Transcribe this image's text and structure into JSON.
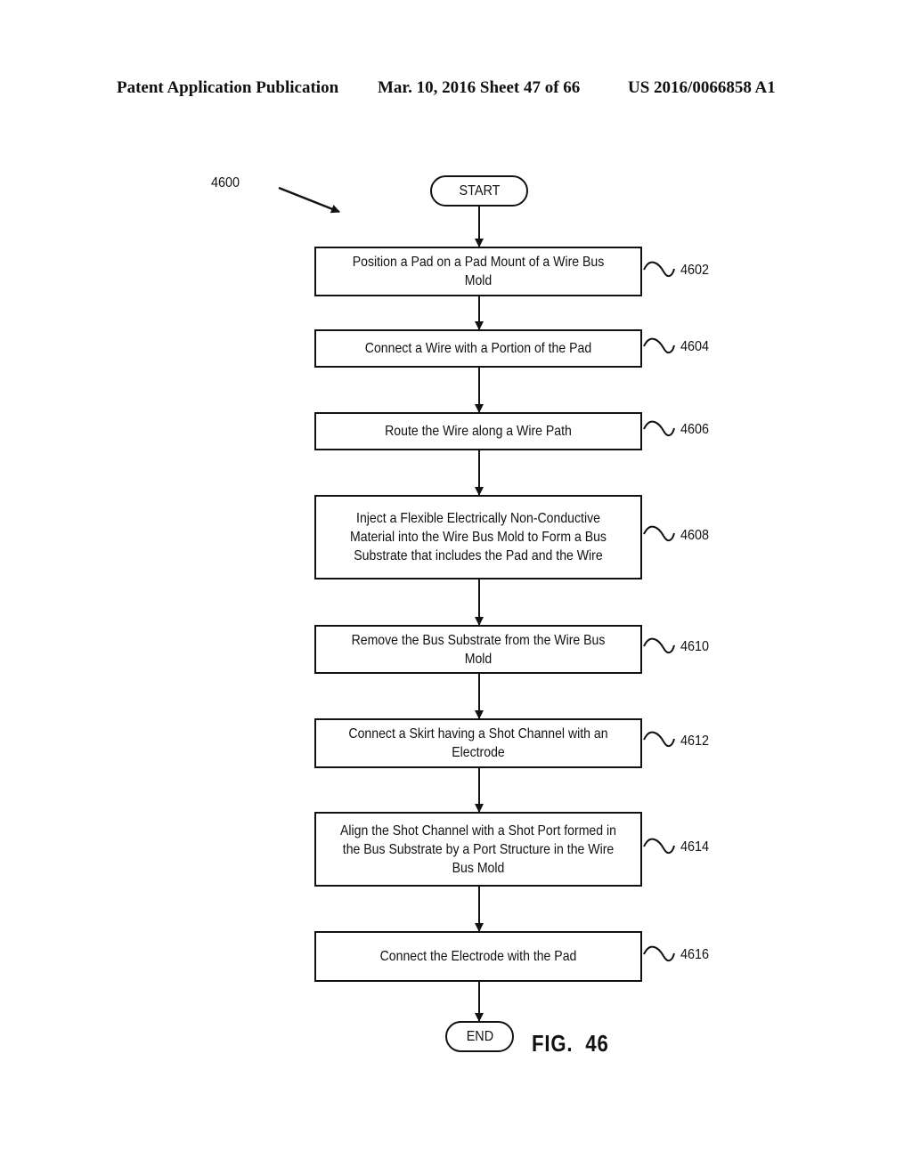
{
  "header": {
    "publication": "Patent Application Publication",
    "date_sheet": "Mar. 10, 2016  Sheet 47 of 66",
    "patent_number": "US 2016/0066858 A1"
  },
  "figure": {
    "reference": "4600",
    "caption": "FIG.  46",
    "start_label": "START",
    "end_label": "END",
    "steps": [
      {
        "id": "4602",
        "text": "Position a Pad on a Pad Mount of a Wire Bus Mold"
      },
      {
        "id": "4604",
        "text": "Connect a Wire with a Portion of the Pad"
      },
      {
        "id": "4606",
        "text": "Route the Wire along a Wire Path"
      },
      {
        "id": "4608",
        "text": "Inject a Flexible Electrically Non-Conductive Material into the Wire Bus Mold to Form a Bus Substrate that includes the Pad and the Wire"
      },
      {
        "id": "4610",
        "text": "Remove the Bus Substrate from the Wire Bus Mold"
      },
      {
        "id": "4612",
        "text": "Connect a Skirt having a Shot Channel with an Electrode"
      },
      {
        "id": "4614",
        "text": "Align the Shot Channel with a Shot Port formed in the Bus Substrate by a Port Structure in the Wire Bus Mold"
      },
      {
        "id": "4616",
        "text": "Connect the Electrode with the Pad"
      }
    ]
  }
}
